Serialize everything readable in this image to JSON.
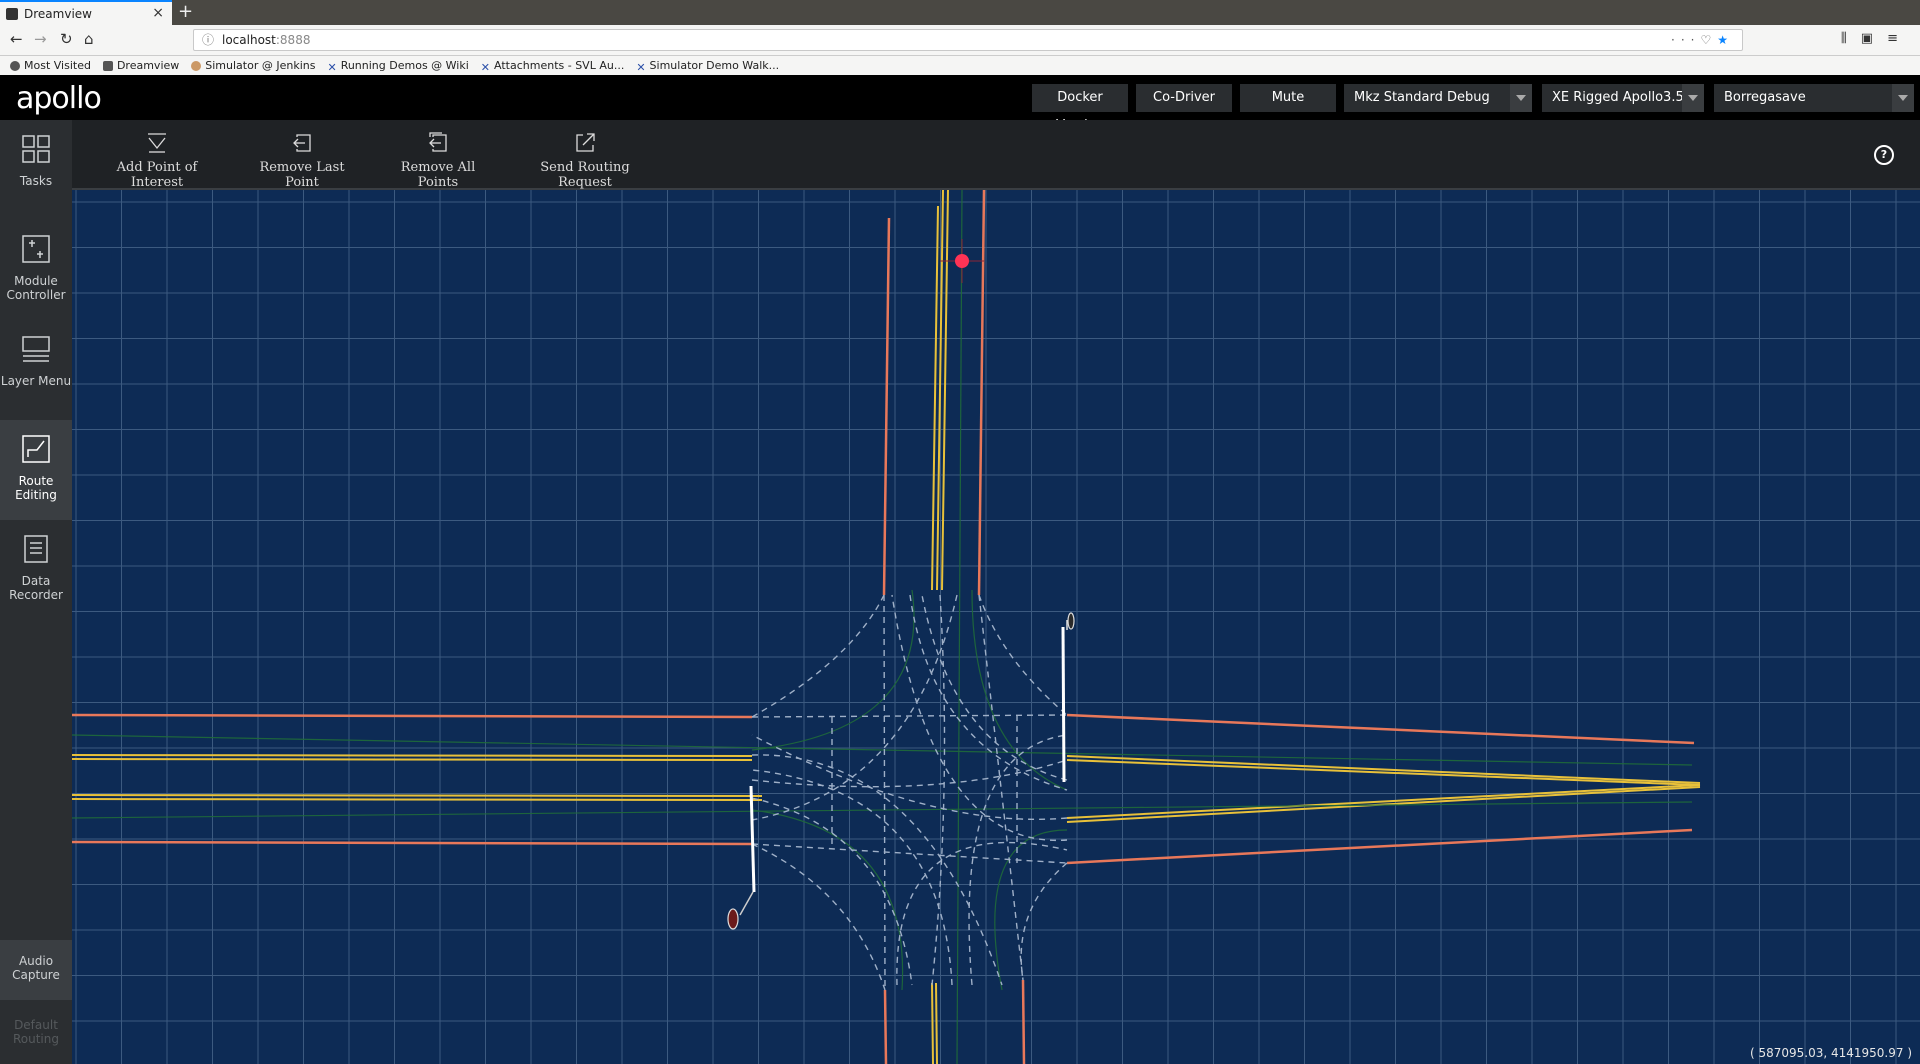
{
  "browser": {
    "tab_title": "Dreamview",
    "new_tab": "+",
    "url_host": "localhost",
    "url_port": ":8888",
    "bookmarks": [
      {
        "label": "Most Visited",
        "icon": "gear-icon"
      },
      {
        "label": "Dreamview",
        "icon": "dreamview-favicon"
      },
      {
        "label": "Simulator @ Jenkins",
        "icon": "jenkins-icon"
      },
      {
        "label": "Running Demos @ Wiki",
        "icon": "confluence-icon"
      },
      {
        "label": "Attachments - SVL Au...",
        "icon": "confluence-icon"
      },
      {
        "label": "Simulator Demo Walk...",
        "icon": "confluence-icon"
      }
    ]
  },
  "header": {
    "logo": "apollo",
    "docker_version": "Docker Version",
    "co_driver": "Co-Driver",
    "mute": "Mute",
    "mode_select": "Mkz Standard Debug",
    "vehicle_select": "XE Rigged Apollo3.5",
    "map_select": "Borregasave"
  },
  "sidebar": {
    "items": [
      {
        "label": "Tasks",
        "icon": "grid-icon"
      },
      {
        "label": "Module Controller",
        "icon": "module-controller-icon"
      },
      {
        "label": "Layer Menu",
        "icon": "layer-menu-icon"
      },
      {
        "label": "Route Editing",
        "icon": "route-editing-icon",
        "active": true
      },
      {
        "label": "Data Recorder",
        "icon": "document-icon"
      }
    ],
    "audio_capture": "Audio Capture",
    "default_routing": "Default Routing"
  },
  "toolbar": {
    "add_poi": "Add Point of Interest",
    "remove_last": "Remove Last Point",
    "remove_all": "Remove All Points",
    "send_routing": "Send Routing Request",
    "help": "?"
  },
  "map": {
    "coordinates": "( 587095.03, 4141950.97 )",
    "colors": {
      "background": "#0d2b55",
      "grid": "#3c5a80",
      "lane_boundary": "#e8785a",
      "center_line": "#e8c13a",
      "junction_dash": "#9fb0c8",
      "stop_line": "#ffffff",
      "marker": "#ff3355"
    }
  }
}
